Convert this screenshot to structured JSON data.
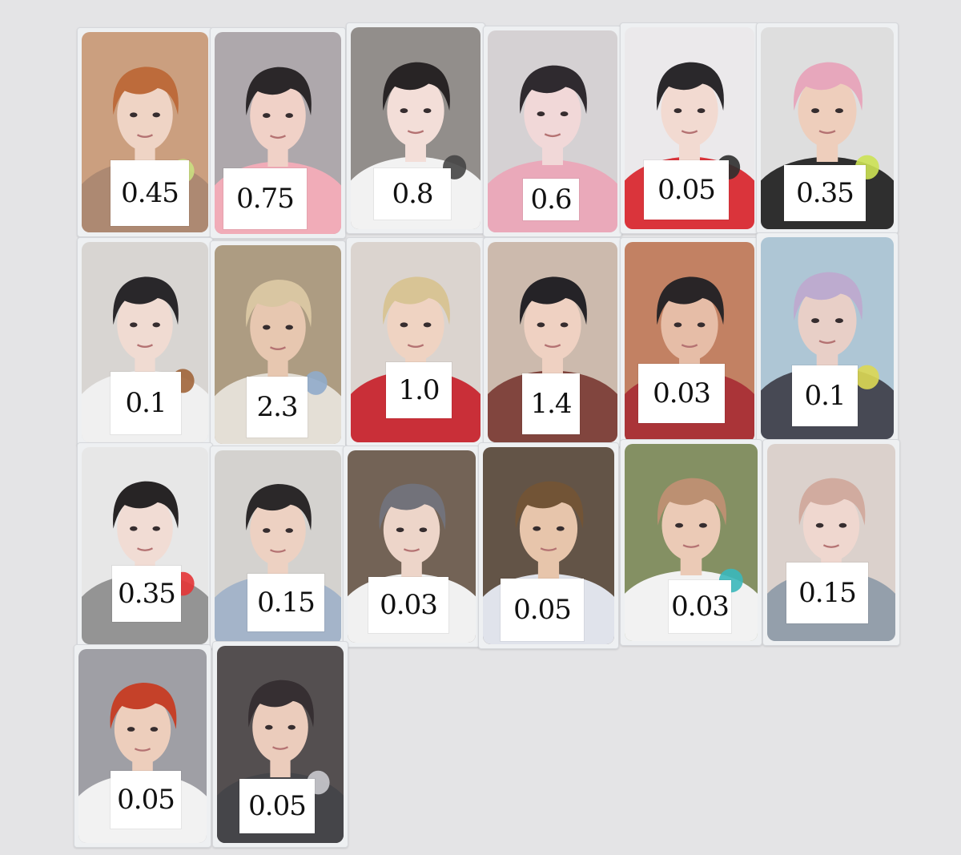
{
  "background": "#e4e4e6",
  "cards": [
    {
      "price": "0.45",
      "hair": "#b9622f",
      "skin": "#efd2c2",
      "top": "#a8826a",
      "bg": "#c89a78",
      "accent": "#c7de7a"
    },
    {
      "price": "0.75",
      "hair": "#1e1a1c",
      "skin": "#f0cfc4",
      "top": "#f1a7b4",
      "bg": "#a9a3a7",
      "accent": null
    },
    {
      "price": "0.8",
      "hair": "#1b1718",
      "skin": "#f3dcd6",
      "top": "#f2f2f2",
      "bg": "#8c8784",
      "accent": "#3a3a3a"
    },
    {
      "price": "0.6",
      "hair": "#221d22",
      "skin": "#f1d6d6",
      "top": "#e9a4b6",
      "bg": "#d3cfd1",
      "accent": null
    },
    {
      "price": "0.05",
      "hair": "#1d1b1e",
      "skin": "#f2d8cf",
      "top": "#d8282f",
      "bg": "#eae8ea",
      "accent": "#222222"
    },
    {
      "price": "0.35",
      "hair": "#e6a2b8",
      "skin": "#edcbb8",
      "top": "#222222",
      "bg": "#dcdcdc",
      "accent": "#c9e14a"
    },
    {
      "price": "0.1",
      "hair": "#1c1a1d",
      "skin": "#f0d9d0",
      "top": "#f0f0f0",
      "bg": "#d6d3d0",
      "accent": "#9b5c2e"
    },
    {
      "price": "2.3",
      "hair": "#d7c39d",
      "skin": "#e6c4ac",
      "top": "#e3ddd4",
      "bg": "#a8967b",
      "accent": "#8aa6c8"
    },
    {
      "price": "1.0",
      "hair": "#d6c18f",
      "skin": "#efd1bf",
      "top": "#c6222c",
      "bg": "#d9d2cc",
      "accent": null
    },
    {
      "price": "1.4",
      "hair": "#18161a",
      "skin": "#efcfbf",
      "top": "#7a3a32",
      "bg": "#c9b6a8",
      "accent": null
    },
    {
      "price": "0.03",
      "hair": "#1c181a",
      "skin": "#e5b9a2",
      "top": "#a5282c",
      "bg": "#bf7a5a",
      "accent": null
    },
    {
      "price": "0.1",
      "hair": "#b9a6cc",
      "skin": "#e7cdc4",
      "top": "#3c3e4a",
      "bg": "#a9c3d3",
      "accent": "#d9d64a"
    },
    {
      "price": "0.35",
      "hair": "#1a1718",
      "skin": "#f1dad2",
      "top": "#8e8e8e",
      "bg": "#e6e6e6",
      "accent": "#e3282a"
    },
    {
      "price": "0.15",
      "hair": "#1e1b1c",
      "skin": "#eccfbf",
      "top": "#9fb0c6",
      "bg": "#d2d0cc",
      "accent": null
    },
    {
      "price": "0.03",
      "hair": "#6a6a72",
      "skin": "#ecd3c6",
      "top": "#f1f1f1",
      "bg": "#6b5a4c",
      "accent": null
    },
    {
      "price": "0.05",
      "hair": "#6a4a2a",
      "skin": "#e6c2a6",
      "top": "#dfe2ea",
      "bg": "#5a4a3c",
      "accent": null
    },
    {
      "price": "0.03",
      "hair": "#b88a6a",
      "skin": "#eac7b2",
      "top": "#f2f2f2",
      "bg": "#7d8a5a",
      "accent": "#2fb4b8"
    },
    {
      "price": "0.15",
      "hair": "#cfa69a",
      "skin": "#efd5cc",
      "top": "#8e9aa6",
      "bg": "#d9cfc9",
      "accent": null
    },
    {
      "price": "0.05",
      "hair": "#c2361c",
      "skin": "#eccbb8",
      "top": "#f2f2f2",
      "bg": "#9a9aa0",
      "accent": null
    },
    {
      "price": "0.05",
      "hair": "#2a2326",
      "skin": "#eac9b8",
      "top": "#3a3a3e",
      "bg": "#4a4446",
      "accent": "#c7c7cc"
    }
  ]
}
